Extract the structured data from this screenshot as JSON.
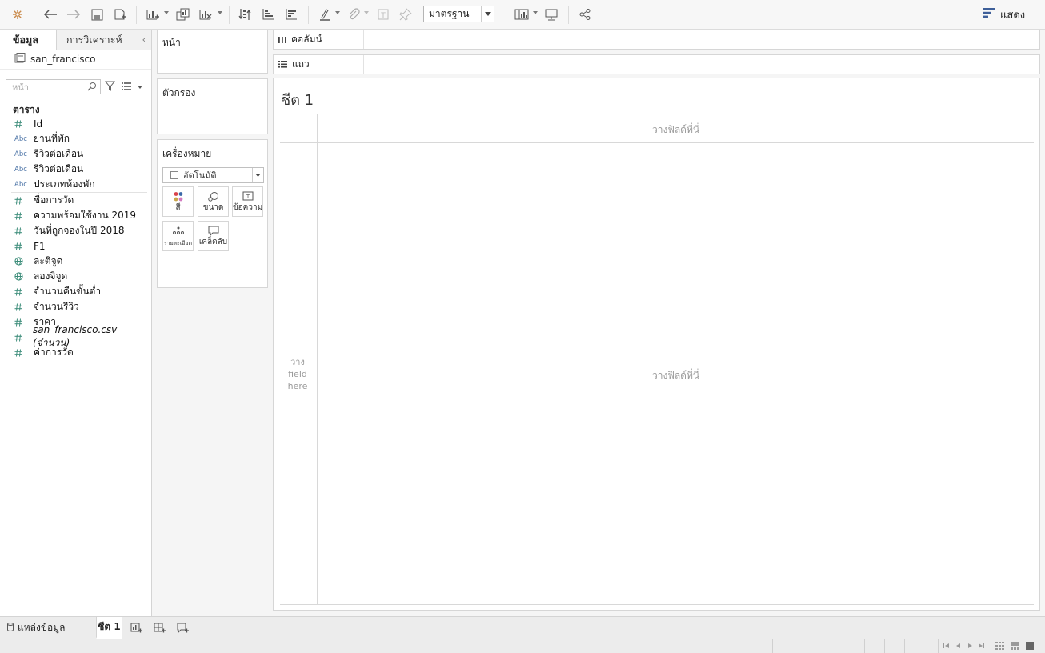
{
  "toolbar": {
    "view_type_value": "มาตรฐาน",
    "show_me_label": "แสดง"
  },
  "data_pane": {
    "tab_data": "ข้อมูล",
    "tab_analytics": "การวิเคราะห์",
    "datasource": "san_francisco",
    "search_placeholder": "หน้า",
    "section_title": "ตาราง",
    "dimensions": [
      {
        "type": "#",
        "name": "Id"
      },
      {
        "type": "Abc",
        "name": "ย่านที่พัก"
      },
      {
        "type": "Abc",
        "name": "รีวิวต่อเดือน"
      },
      {
        "type": "Abc",
        "name": "รีวิวต่อเดือน"
      },
      {
        "type": "Abc",
        "name": "ประเภทห้องพัก"
      }
    ],
    "measures": [
      {
        "type": "#",
        "name": "ชื่อการวัด"
      },
      {
        "type": "#",
        "name": "ความพร้อมใช้งาน 2019"
      },
      {
        "type": "#",
        "name": "วันที่ถูกจองในปี 2018"
      },
      {
        "type": "#",
        "name": "F1"
      },
      {
        "type": "globe",
        "name": "ละติจูด"
      },
      {
        "type": "globe",
        "name": "ลองจิจูด"
      },
      {
        "type": "#",
        "name": "จำนวนคืนขั้นต่ำ"
      },
      {
        "type": "#",
        "name": "จำนวนรีวิว"
      },
      {
        "type": "#",
        "name": "ราคา"
      },
      {
        "type": "#",
        "name": "san_francisco.csv (จำนวน)"
      },
      {
        "type": "#",
        "name": "ค่าการวัด"
      }
    ]
  },
  "cards": {
    "pages": "หน้า",
    "filters": "ตัวกรอง",
    "marks": "เครื่องหมาย",
    "marks_type": "อัตโนมัติ",
    "marks_buttons": {
      "color": "สี",
      "size": "ขนาด",
      "text": "ข้อความ",
      "detail": "รายละเอียด",
      "tooltip": "เคล็ดลับ"
    }
  },
  "shelves": {
    "columns": "คอลัมน์",
    "rows": "แถว"
  },
  "view": {
    "sheet_title": "ชีต 1",
    "drop_top": "วางฟิลด์ที่นี่",
    "drop_center": "วางฟิลด์ที่นี่",
    "drop_rows_1": "วาง",
    "drop_rows_2": "field",
    "drop_rows_3": "here"
  },
  "tabs": {
    "datasource_tab": "แหล่งข้อมูล",
    "sheet_tab": "ชีต 1"
  }
}
